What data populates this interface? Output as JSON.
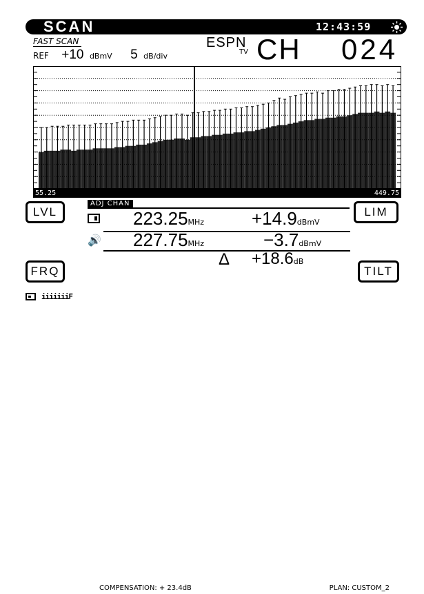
{
  "header": {
    "title": "SCAN",
    "clock": "12:43:59",
    "mode": "FAST SCAN",
    "ref_label": "REF",
    "ref_value": "+10",
    "ref_unit": "dBmV",
    "scale_value": "5",
    "scale_unit": "dB/div",
    "channel_name": "ESPN",
    "channel_sub": "TV",
    "ch_label": "CH",
    "ch_number": "024"
  },
  "spectrum": {
    "freq_start": "55.25",
    "freq_end": "449.75",
    "marker_channel_index": 24,
    "bar_count": 66,
    "video_levels_fraction": [
      0.5,
      0.5,
      0.51,
      0.51,
      0.51,
      0.52,
      0.52,
      0.52,
      0.52,
      0.52,
      0.53,
      0.53,
      0.53,
      0.53,
      0.54,
      0.55,
      0.55,
      0.56,
      0.56,
      0.56,
      0.57,
      0.58,
      0.59,
      0.6,
      0.6,
      0.61,
      0.61,
      0.6,
      0.62,
      0.62,
      0.63,
      0.63,
      0.64,
      0.64,
      0.65,
      0.65,
      0.66,
      0.66,
      0.67,
      0.67,
      0.68,
      0.69,
      0.7,
      0.72,
      0.74,
      0.73,
      0.75,
      0.76,
      0.77,
      0.78,
      0.78,
      0.79,
      0.78,
      0.8,
      0.8,
      0.81,
      0.81,
      0.82,
      0.83,
      0.84,
      0.84,
      0.85,
      0.85,
      0.84,
      0.85,
      0.84
    ],
    "audio_levels_fraction": [
      0.3,
      0.31,
      0.31,
      0.31,
      0.32,
      0.32,
      0.31,
      0.32,
      0.32,
      0.32,
      0.33,
      0.33,
      0.33,
      0.33,
      0.34,
      0.34,
      0.35,
      0.35,
      0.36,
      0.36,
      0.37,
      0.38,
      0.39,
      0.4,
      0.4,
      0.41,
      0.41,
      0.4,
      0.42,
      0.42,
      0.43,
      0.43,
      0.44,
      0.44,
      0.45,
      0.45,
      0.46,
      0.46,
      0.47,
      0.47,
      0.48,
      0.49,
      0.5,
      0.51,
      0.52,
      0.52,
      0.53,
      0.54,
      0.55,
      0.56,
      0.56,
      0.57,
      0.57,
      0.58,
      0.58,
      0.59,
      0.59,
      0.6,
      0.61,
      0.62,
      0.62,
      0.62,
      0.63,
      0.62,
      0.63,
      0.62
    ]
  },
  "buttons": {
    "lvl": "LVL",
    "lim": "LIM",
    "frq": "FRQ",
    "tilt": "TILT"
  },
  "readout": {
    "tag": "ADJ CHAN",
    "video_freq": "223.25",
    "video_freq_unit": "MHz",
    "video_level": "+14.9",
    "video_level_unit": "dBmV",
    "audio_freq": "227.75",
    "audio_freq_unit": "MHz",
    "audio_level": "−3.7",
    "audio_level_unit": "dBmV",
    "delta_symbol": "Δ",
    "delta_value": "+18.6",
    "delta_unit": "dB"
  },
  "status": {
    "ticks": "iiiiiiiF",
    "compensation": "COMPENSATION: + 23.4dB",
    "plan": "PLAN: CUSTOM_2"
  }
}
